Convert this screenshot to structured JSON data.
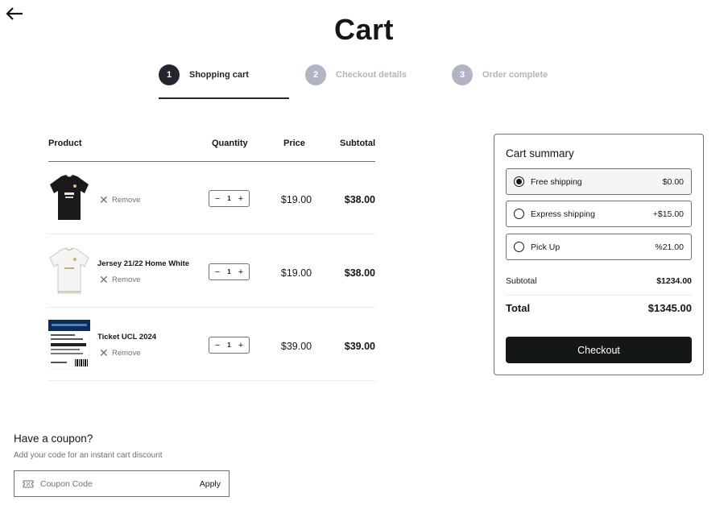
{
  "header": {
    "title": "Cart",
    "back_icon": "arrow-left-icon"
  },
  "steps": [
    {
      "number": "1",
      "label": "Shopping cart",
      "state": "active"
    },
    {
      "number": "2",
      "label": "Checkout details",
      "state": "inactive"
    },
    {
      "number": "3",
      "label": "Order complete",
      "state": "inactive"
    }
  ],
  "table": {
    "headers": {
      "product": "Product",
      "quantity": "Quantity",
      "price": "Price",
      "subtotal": "Subtotal"
    },
    "remove_label": "Remove",
    "rows": [
      {
        "name": "",
        "quantity": "1",
        "price": "$19.00",
        "subtotal": "$38.00",
        "image": "black-jersey"
      },
      {
        "name": "Jersey 21/22 Home White",
        "quantity": "1",
        "price": "$19.00",
        "subtotal": "$38.00",
        "image": "white-jersey"
      },
      {
        "name": "Ticket UCL 2024",
        "quantity": "1",
        "price": "$39.00",
        "subtotal": "$39.00",
        "image": "ticket"
      }
    ]
  },
  "summary": {
    "title": "Cart summary",
    "shipping_options": [
      {
        "label": "Free shipping",
        "price": "$0.00",
        "selected": true
      },
      {
        "label": "Express shipping",
        "price": "+$15.00",
        "selected": false
      },
      {
        "label": "Pick Up",
        "price": "%21.00",
        "selected": false
      }
    ],
    "subtotal_label": "Subtotal",
    "subtotal_value": "$1234.00",
    "total_label": "Total",
    "total_value": "$1345.00",
    "checkout_label": "Checkout"
  },
  "coupon": {
    "title": "Have a coupon?",
    "subtitle": "Add your code for an instant cart discount",
    "placeholder": "Coupon Code",
    "apply_label": "Apply",
    "icon": "ticket-icon"
  },
  "colors": {
    "primary": "#141718",
    "muted": "#6c7275",
    "step_inactive": "#b1b5c3",
    "border": "#e8ecef"
  }
}
